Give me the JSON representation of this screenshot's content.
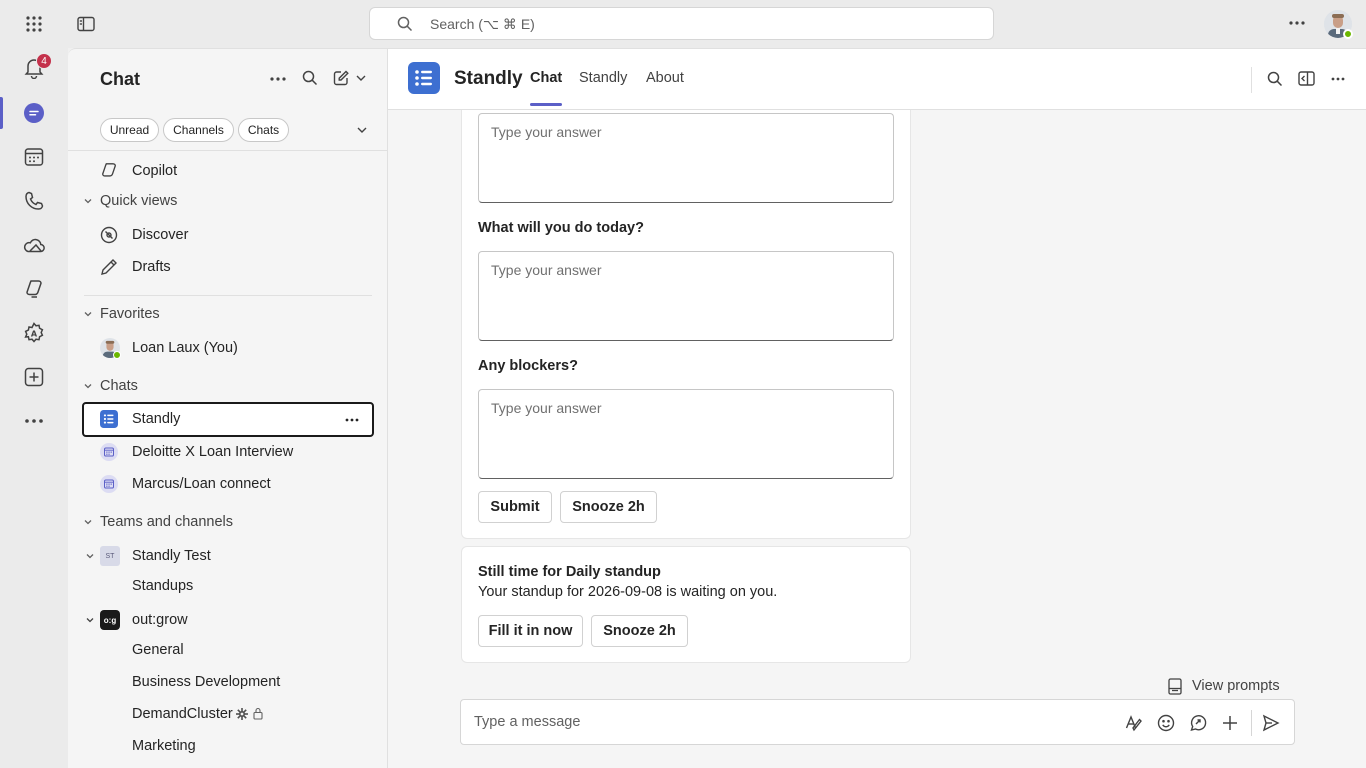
{
  "topbar": {
    "search_placeholder": "Search (⌥ ⌘ E)",
    "icons": [
      "app-launcher-icon",
      "sidebar-toggle-icon",
      "search-icon",
      "more-icon",
      "avatar"
    ]
  },
  "rail": {
    "notifications_badge": "4",
    "items": [
      "bell-icon",
      "chat-icon",
      "calendar-icon",
      "calls-icon",
      "onedrive-icon",
      "copilot-icon",
      "apps-icon",
      "add-icon",
      "more-icon"
    ]
  },
  "panel": {
    "title": "Chat",
    "filters": [
      "Unread",
      "Channels",
      "Chats"
    ],
    "copilot": "Copilot",
    "quick_views": {
      "label": "Quick views",
      "items": [
        "Discover",
        "Drafts"
      ]
    },
    "favorites": {
      "label": "Favorites",
      "items": [
        "Loan Laux (You)"
      ]
    },
    "chats": {
      "label": "Chats",
      "items": [
        "Standly",
        "Deloitte X Loan Interview",
        "Marcus/Loan connect"
      ]
    },
    "teams": {
      "label": "Teams and channels",
      "team1": {
        "name": "Standly Test",
        "badge": "ST",
        "channels": [
          "Standups"
        ]
      },
      "team2": {
        "name": "out:grow",
        "badge": "o:g",
        "channels": [
          "General",
          "Business Development",
          "DemandCluster",
          "Marketing"
        ]
      }
    }
  },
  "main": {
    "app_name": "Standly",
    "tabs": [
      "Chat",
      "Standly",
      "About"
    ],
    "active_tab": "Chat",
    "form": {
      "placeholder": "Type your answer",
      "q2": "What will you do today?",
      "q3": "Any blockers?",
      "submit": "Submit",
      "snooze": "Snooze 2h"
    },
    "reminder": {
      "title": "Still time for Daily standup",
      "body": "Your standup for 2026-09-08 is waiting on you.",
      "fill": "Fill it in now",
      "snooze": "Snooze 2h"
    },
    "view_prompts": "View prompts",
    "compose_placeholder": "Type a message"
  },
  "colors": {
    "accent": "#5b5fc7",
    "app_blue": "#3d6fd1",
    "badge_red": "#c4314b",
    "presence": "#6bb700"
  }
}
